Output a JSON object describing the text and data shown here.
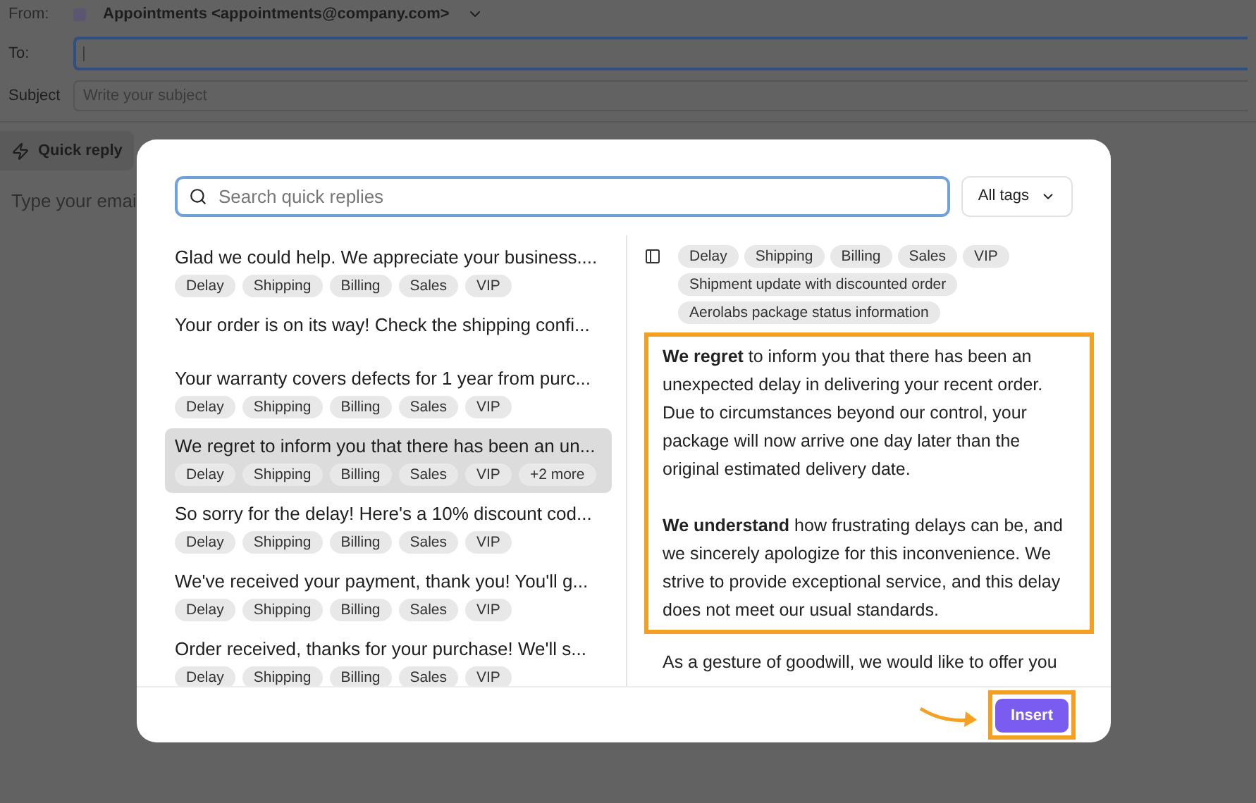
{
  "composer": {
    "from_label": "From:",
    "from_value": "Appointments <appointments@company.com>",
    "to_label": "To:",
    "to_value": "|",
    "subject_label": "Subject",
    "subject_placeholder": "Write your subject",
    "quick_reply_button": "Quick reply",
    "body_placeholder": "Type your emai"
  },
  "modal": {
    "search_placeholder": "Search quick replies",
    "tags_filter": "All tags",
    "replies": [
      {
        "text": "Glad we could help. We appreciate your business....",
        "tags": [
          "Delay",
          "Shipping",
          "Billing",
          "Sales",
          "VIP"
        ],
        "selected": false
      },
      {
        "text": "Your order is on its way! Check the shipping confi...",
        "selected": false
      },
      {
        "text": "Your warranty covers defects for 1 year from purc...",
        "tags": [
          "Delay",
          "Shipping",
          "Billing",
          "Sales",
          "VIP"
        ],
        "selected": false
      },
      {
        "text": "We regret to inform you that there has been an un...",
        "tags": [
          "Delay",
          "Shipping",
          "Billing",
          "Sales",
          "VIP"
        ],
        "more": "+2 more",
        "selected": true
      },
      {
        "text": "So sorry for the delay! Here's a 10% discount cod...",
        "tags": [
          "Delay",
          "Shipping",
          "Billing",
          "Sales",
          "VIP"
        ],
        "selected": false
      },
      {
        "text": "We've received your payment, thank you! You'll g...",
        "tags": [
          "Delay",
          "Shipping",
          "Billing",
          "Sales",
          "VIP"
        ],
        "selected": false
      },
      {
        "text": "Order received, thanks for your purchase! We'll s...",
        "tags": [
          "Delay",
          "Shipping",
          "Billing",
          "Sales",
          "VIP"
        ],
        "selected": false
      }
    ],
    "preview": {
      "tags": [
        "Delay",
        "Shipping",
        "Billing",
        "Sales",
        "VIP",
        "Shipment update with discounted order",
        "Aerolabs package status information"
      ],
      "highlighted": true,
      "paragraphs": [
        "**We regret** to inform you that there has been an unexpected delay in delivering your recent order. Due to circumstances beyond our control, your package will now arrive one day later than the original estimated delivery date.",
        "**We understand** how frustrating delays can be, and we sincerely apologize for this inconvenience. We strive to provide exceptional service, and this delay does not meet our usual standards."
      ],
      "continuation": "As a gesture of goodwill, we would like to offer you"
    },
    "insert_button": {
      "label": "Insert",
      "highlighted": true
    }
  }
}
